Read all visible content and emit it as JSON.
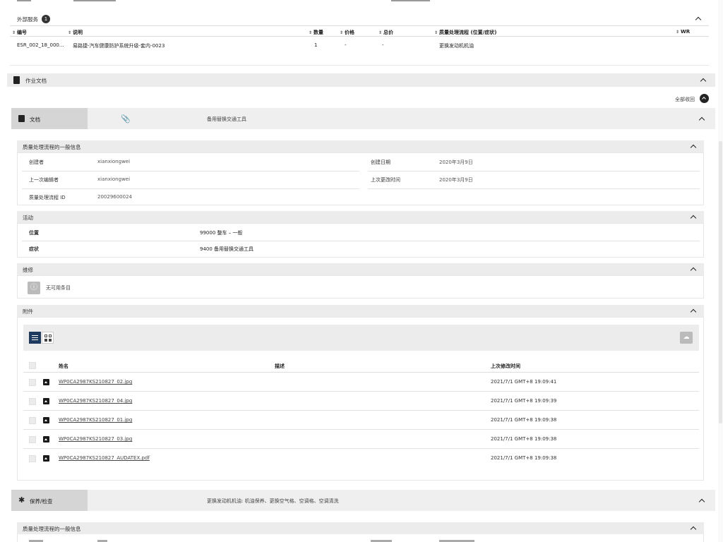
{
  "ext": {
    "title": "外部服务",
    "count": "1",
    "headers": [
      "编号",
      "说明",
      "数量",
      "价格",
      "总价",
      "质量处理流程 (位置/症状)",
      "WR"
    ],
    "row": [
      "ESR_002_18_000...",
      "易路捷-汽车健康防护系统升级-套内-0023",
      "1",
      "-",
      "-",
      "更换发动机机油",
      ""
    ]
  },
  "workdocs": {
    "title": "作业文档",
    "collapse_all": "全部收回"
  },
  "doc_tab": {
    "label": "文档",
    "subject": "备用替换交通工具"
  },
  "general": {
    "title": "质量处理流程的一般信息",
    "creator_label": "创建者",
    "creator": "xianxiongwei",
    "created_label": "创建日期",
    "created": "2020年3月9日",
    "editor_label": "上一次编辑者",
    "editor": "xianxiongwei",
    "modified_label": "上次更改时间",
    "modified": "2020年3月9日",
    "id_label": "质量处理流程 ID",
    "id": "20029600024"
  },
  "activity": {
    "title": "活动",
    "location_label": "位置",
    "location": "99000 整车 – 一般",
    "symptom_label": "症状",
    "symptom": "9400 备用替换交通工具"
  },
  "repair": {
    "title": "维修",
    "empty": "无可用条目"
  },
  "attachments": {
    "title": "附件",
    "headers": {
      "name": "姓名",
      "desc": "描述",
      "modified": "上次修改时间"
    },
    "files": [
      {
        "name": "WP0CA2987KS210827_02.jpg",
        "time": "2021/7/1 GMT+8 19:09:41"
      },
      {
        "name": "WP0CA2987KS210827_04.jpg",
        "time": "2021/7/1 GMT+8 19:09:39"
      },
      {
        "name": "WP0CA2987KS210827_01.jpg",
        "time": "2021/7/1 GMT+8 19:09:38"
      },
      {
        "name": "WP0CA2987KS210827_03.jpg",
        "time": "2021/7/1 GMT+8 19:09:38"
      },
      {
        "name": "WP0CA2987KS210827_AUDATEX.pdf",
        "time": "2021/7/1 GMT+8 19:09:38"
      }
    ]
  },
  "maint_tab": {
    "label": "保养/检查",
    "subject": "更换发动机机油: 机油保养、更换空气格、空调格、空调清洗"
  },
  "general2": {
    "title": "质量处理流程的一般信息"
  }
}
